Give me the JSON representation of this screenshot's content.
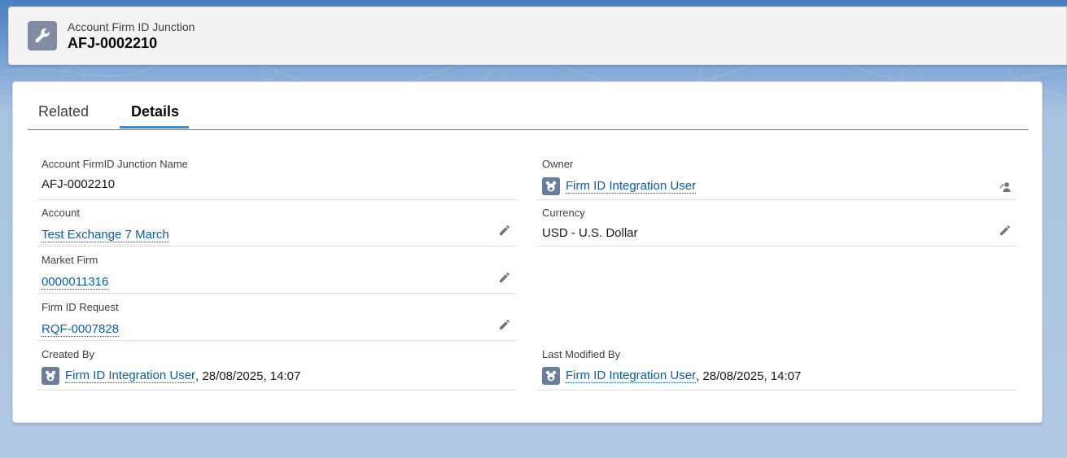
{
  "header": {
    "object_type": "Account Firm ID Junction",
    "record_name": "AFJ-0002210",
    "icon": "wrench-icon",
    "icon_bg": "#7f8ca1"
  },
  "tabs": [
    {
      "label": "Related",
      "active": false
    },
    {
      "label": "Details",
      "active": true
    }
  ],
  "fields": {
    "name": {
      "label": "Account FirmID Junction Name",
      "value": "AFJ-0002210"
    },
    "owner": {
      "label": "Owner",
      "value": "Firm ID Integration User"
    },
    "account": {
      "label": "Account",
      "value": "Test Exchange 7 March"
    },
    "currency": {
      "label": "Currency",
      "value": "USD - U.S. Dollar"
    },
    "market_firm": {
      "label": "Market Firm",
      "value": "0000011316"
    },
    "firm_id_request": {
      "label": "Firm ID Request",
      "value": "RQF-0007828"
    },
    "created_by": {
      "label": "Created By",
      "user": "Firm ID Integration User",
      "datetime": ", 28/08/2025, 14:07"
    },
    "last_modified_by": {
      "label": "Last Modified By",
      "user": "Firm ID Integration User",
      "datetime": ", 28/08/2025, 14:07"
    }
  },
  "colors": {
    "link": "#0b5cab",
    "tab_active_underline": "#1b96ff"
  }
}
